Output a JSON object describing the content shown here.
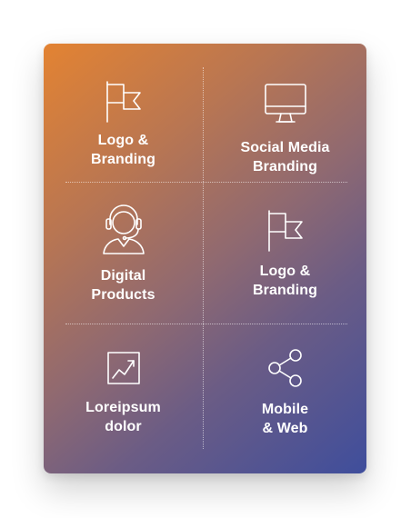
{
  "tiles": [
    {
      "label": "Logo &\nBranding",
      "icon": "flag-icon"
    },
    {
      "label": "Social Media\nBranding",
      "icon": "monitor-icon"
    },
    {
      "label": "Digital\nProducts",
      "icon": "headset-support-icon"
    },
    {
      "label": "Logo &\nBranding",
      "icon": "flag-icon"
    },
    {
      "label": "Loreipsum\ndolor",
      "icon": "trend-chart-icon"
    },
    {
      "label": "Mobile\n& Web",
      "icon": "share-network-icon"
    }
  ],
  "colors": {
    "gradient_start": "#E38332",
    "gradient_end": "#3F4E9C",
    "text": "#FFFFFF"
  }
}
